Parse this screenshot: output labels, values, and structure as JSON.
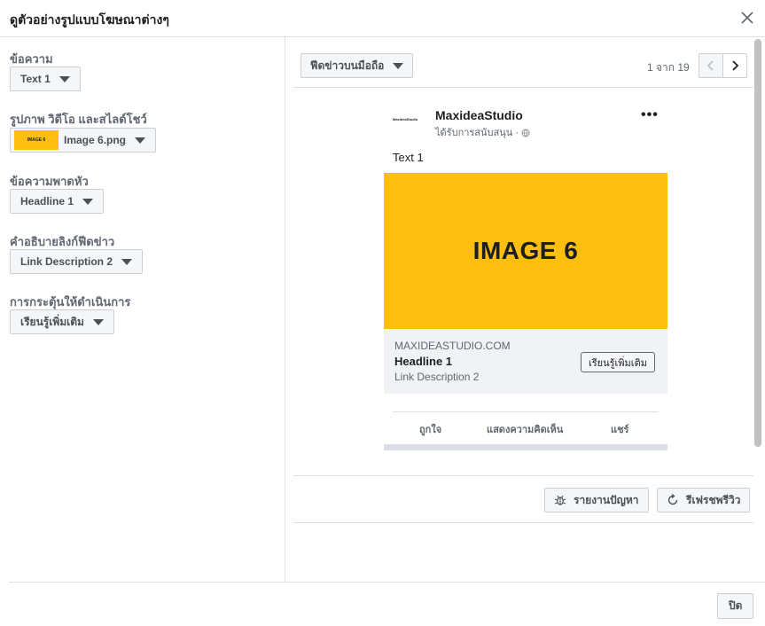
{
  "dialog": {
    "title": "ดูตัวอย่างรูปแบบโฆษณาต่างๆ",
    "close_icon": "close-icon"
  },
  "left": {
    "fields": [
      {
        "label": "ข้อความ",
        "value": "Text 1"
      },
      {
        "label": "รูปภาพ วิดีโอ และสไลด์โชว์",
        "value": "Image 6.png",
        "thumb_text": "IMAGE 6"
      },
      {
        "label": "ข้อความพาดหัว",
        "value": "Headline 1"
      },
      {
        "label": "คำอธิบายลิงก์ฟีดข่าว",
        "value": "Link Description 2"
      },
      {
        "label": "การกระตุ้นให้ดำเนินการ",
        "value": "เรียนรู้เพิ่มเติม"
      }
    ]
  },
  "preview": {
    "placement": "ฟีดข่าวบนมือถือ",
    "pager": "1 จาก 19",
    "ad": {
      "logo_text": "MaxideaStudio",
      "page_name": "MaxideaStudio",
      "sponsored": "ได้รับการสนับสนุน · ",
      "more": "•••",
      "primary_text": "Text 1",
      "image_text": "IMAGE 6",
      "image_color": "#fdbf0f",
      "domain": "MAXIDEASTUDIO.COM",
      "headline": "Headline 1",
      "description": "Link Description 2",
      "cta": "เรียนรู้เพิ่มเติม",
      "actions": [
        "ถูกใจ",
        "แสดงความคิดเห็น",
        "แชร์"
      ]
    },
    "tools": {
      "report": "รายงานปัญหา",
      "refresh": "รีเฟรชพรีวิว"
    }
  },
  "footer": {
    "close_label": "ปิด"
  }
}
